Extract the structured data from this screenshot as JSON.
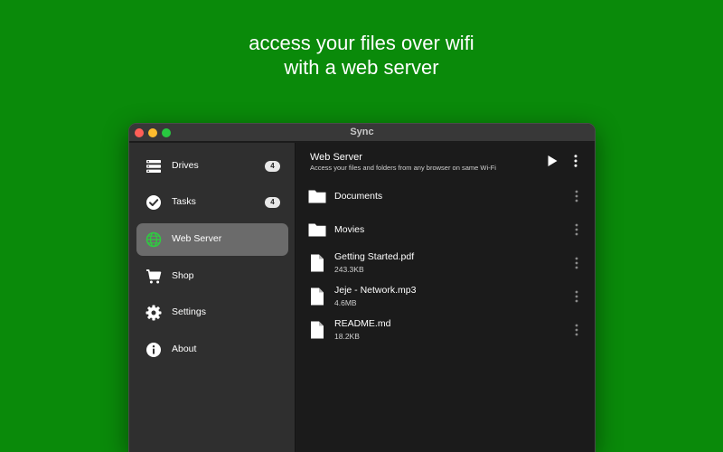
{
  "headline": {
    "line1": "access your files over wifi",
    "line2": "with a web server"
  },
  "window": {
    "title": "Sync"
  },
  "sidebar": {
    "items": [
      {
        "label": "Drives",
        "badge": "4",
        "icon": "drives-icon",
        "active": false
      },
      {
        "label": "Tasks",
        "badge": "4",
        "icon": "check-circle-icon",
        "active": false
      },
      {
        "label": "Web Server",
        "badge": "",
        "icon": "globe-icon",
        "active": true
      },
      {
        "label": "Shop",
        "badge": "",
        "icon": "cart-icon",
        "active": false
      },
      {
        "label": "Settings",
        "badge": "",
        "icon": "gear-icon",
        "active": false
      },
      {
        "label": "About",
        "badge": "",
        "icon": "info-icon",
        "active": false
      }
    ]
  },
  "content": {
    "title": "Web Server",
    "subtitle": "Access your files and folders from any browser on same Wi-Fi",
    "files": [
      {
        "name": "Documents",
        "size": "",
        "type": "folder"
      },
      {
        "name": "Movies",
        "size": "",
        "type": "folder"
      },
      {
        "name": "Getting Started.pdf",
        "size": "243.3KB",
        "type": "file"
      },
      {
        "name": "Jeje - Network.mp3",
        "size": "4.6MB",
        "type": "file"
      },
      {
        "name": "README.md",
        "size": "18.2KB",
        "type": "file"
      }
    ]
  },
  "colors": {
    "background": "#0a8a0a",
    "sidebar": "#2f2f2f",
    "content": "#1b1b1b",
    "active_item": "#6b6b6b",
    "globe_accent": "#2ecc40"
  }
}
